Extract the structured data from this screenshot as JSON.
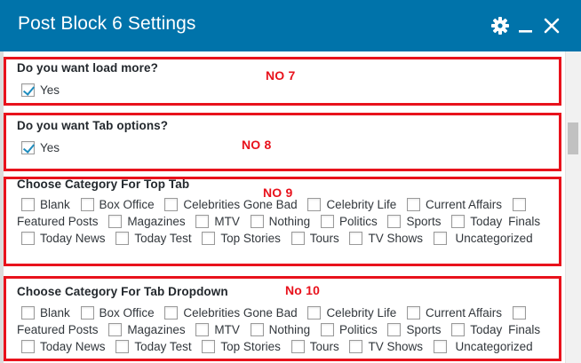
{
  "window": {
    "title": "Post Block 6 Settings"
  },
  "sections": [
    {
      "heading": "Do you want load more?",
      "option": "Yes",
      "checked": true,
      "note": "NO 7"
    },
    {
      "heading": "Do you want Tab options?",
      "option": "Yes",
      "checked": true,
      "note": "NO 8"
    },
    {
      "heading": "Choose Category For Top Tab",
      "note": "NO 9"
    },
    {
      "heading": "Choose Category For Tab Dropdown",
      "note": "No 10"
    }
  ],
  "categories": [
    "Blank",
    "Box Office",
    "Celebrities Gone Bad",
    "Celebrity Life",
    "Current Affairs",
    "Featured Posts",
    "Magazines",
    "MTV",
    "Nothing",
    "Politics",
    "Sports",
    "Today",
    "Finals",
    "Today News",
    "Today Test",
    "Top Stories",
    "Tours",
    "TV Shows",
    "Uncategorized"
  ],
  "colors": {
    "titlebar": "#0073aa",
    "annotation": "#e8121c",
    "check": "#1e8cbe"
  },
  "icons": {
    "settings": "gear-icon",
    "minimize": "minimize-icon",
    "close": "close-icon",
    "check": "checkmark-icon"
  }
}
